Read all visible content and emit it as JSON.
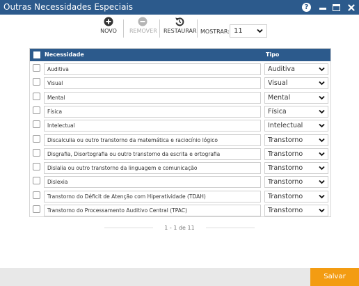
{
  "window": {
    "title": "Outras Necessidades Especiais",
    "help_glyph": "?"
  },
  "toolbar": {
    "novo_label": "NOVO",
    "remover_label": "REMOVER",
    "restaurar_label": "RESTAURAR",
    "mostrar_label": "MOSTRAR:",
    "mostrar_value": "11"
  },
  "grid": {
    "columns": [
      "Necessidade",
      "Tipo"
    ],
    "rows": [
      {
        "necessidade": "Auditiva",
        "tipo": "Auditiva"
      },
      {
        "necessidade": "Visual",
        "tipo": "Visual"
      },
      {
        "necessidade": "Mental",
        "tipo": "Mental"
      },
      {
        "necessidade": "Física",
        "tipo": "Física"
      },
      {
        "necessidade": "Intelectual",
        "tipo": "Intelectual"
      },
      {
        "necessidade": "Discalculia ou outro transtorno da matemática e raciocínio lógico",
        "tipo": "Transtorno"
      },
      {
        "necessidade": "Disgrafia, Disortografia ou outro transtorno da escrita e ortografia",
        "tipo": "Transtorno"
      },
      {
        "necessidade": "Dislalia ou outro transtorno da linguagem e comunicação",
        "tipo": "Transtorno"
      },
      {
        "necessidade": "Dislexia",
        "tipo": "Transtorno"
      },
      {
        "necessidade": "Transtorno do Déficit de Atenção com Hiperatividade (TDAH)",
        "tipo": "Transtorno"
      },
      {
        "necessidade": "Transtorno do Processamento Auditivo Central (TPAC)",
        "tipo": "Transtorno"
      }
    ]
  },
  "pager": {
    "text": "1 - 1 de 11"
  },
  "footer": {
    "save_label": "Salvar"
  },
  "colors": {
    "header_blue": "#2c5a8c",
    "save_orange": "#f39c12"
  }
}
